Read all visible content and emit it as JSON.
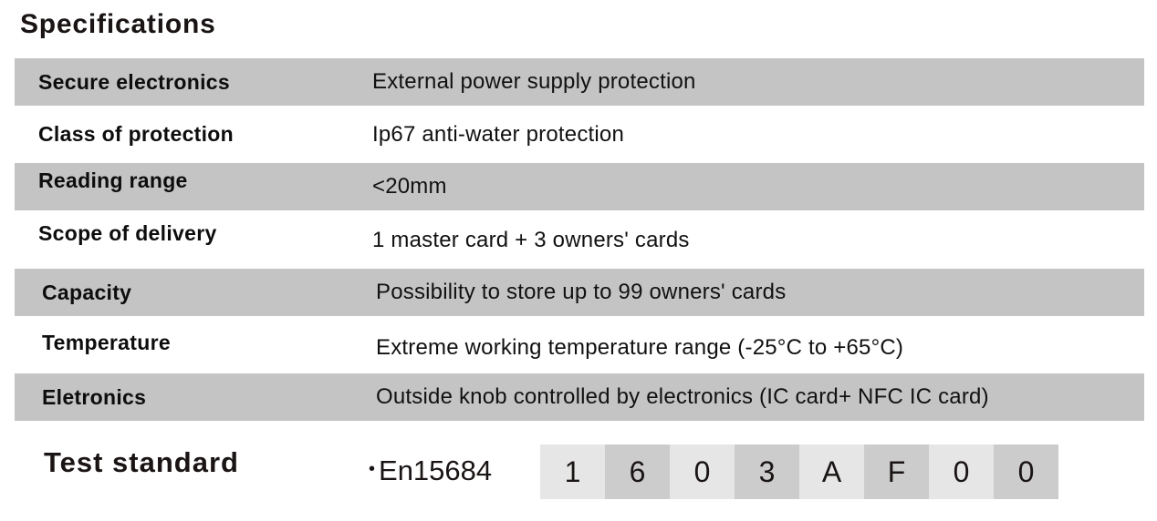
{
  "title": "Specifications",
  "specs": [
    {
      "label": "Secure electronics",
      "value": "External power supply protection"
    },
    {
      "label": "Class of protection",
      "value": "Ip67 anti-water protection"
    },
    {
      "label": "Reading range",
      "value": "<20mm"
    },
    {
      "label": "Scope of delivery",
      "value": "1 master card + 3 owners' cards"
    },
    {
      "label": "Capacity",
      "value": "Possibility to store up to 99  owners' cards"
    },
    {
      "label": "Temperature",
      "value": "Extreme working temperature range   (-25°C to +65°C)"
    },
    {
      "label": "Eletronics",
      "value": "Outside knob controlled by electronics   (IC card+ NFC IC card)"
    }
  ],
  "test_standard": {
    "label": "Test standard",
    "bullet": "•",
    "standard": "En15684",
    "codes": [
      "1",
      "6",
      "0",
      "3",
      "A",
      "F",
      "0",
      "0"
    ]
  }
}
